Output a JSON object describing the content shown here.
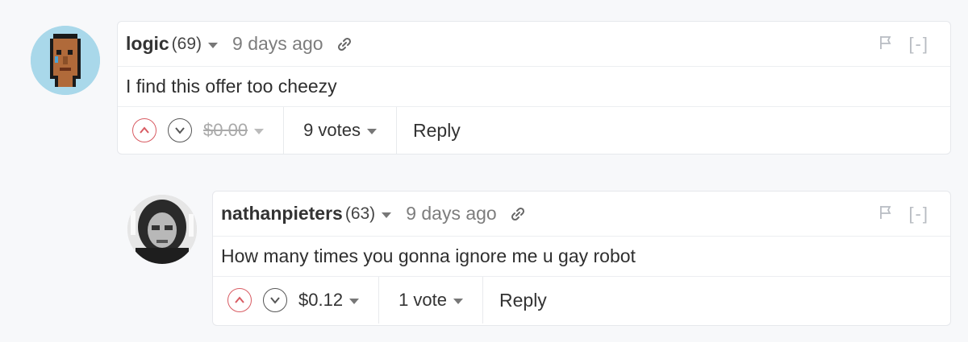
{
  "comments": [
    {
      "username": "logic",
      "karma": "(69)",
      "time": "9 days ago",
      "body": "I find this offer too cheezy",
      "tip": "$0.00",
      "votes": "9 votes",
      "reply": "Reply",
      "collapse": "[-]"
    },
    {
      "username": "nathanpieters",
      "karma": "(63)",
      "time": "9 days ago",
      "body": "How many times you gonna ignore me u gay robot",
      "tip": "$0.12",
      "votes": "1 vote",
      "reply": "Reply",
      "collapse": "[-]"
    }
  ],
  "icons": {
    "link": "link-icon",
    "flag": "flag-icon",
    "upvote": "chevron-up-icon",
    "downvote": "chevron-down-icon"
  },
  "colors": {
    "upvote": "#d85b62",
    "muted": "#7d7d7d",
    "card_border": "#e6e8ec",
    "page_bg": "#f7f8fa"
  }
}
